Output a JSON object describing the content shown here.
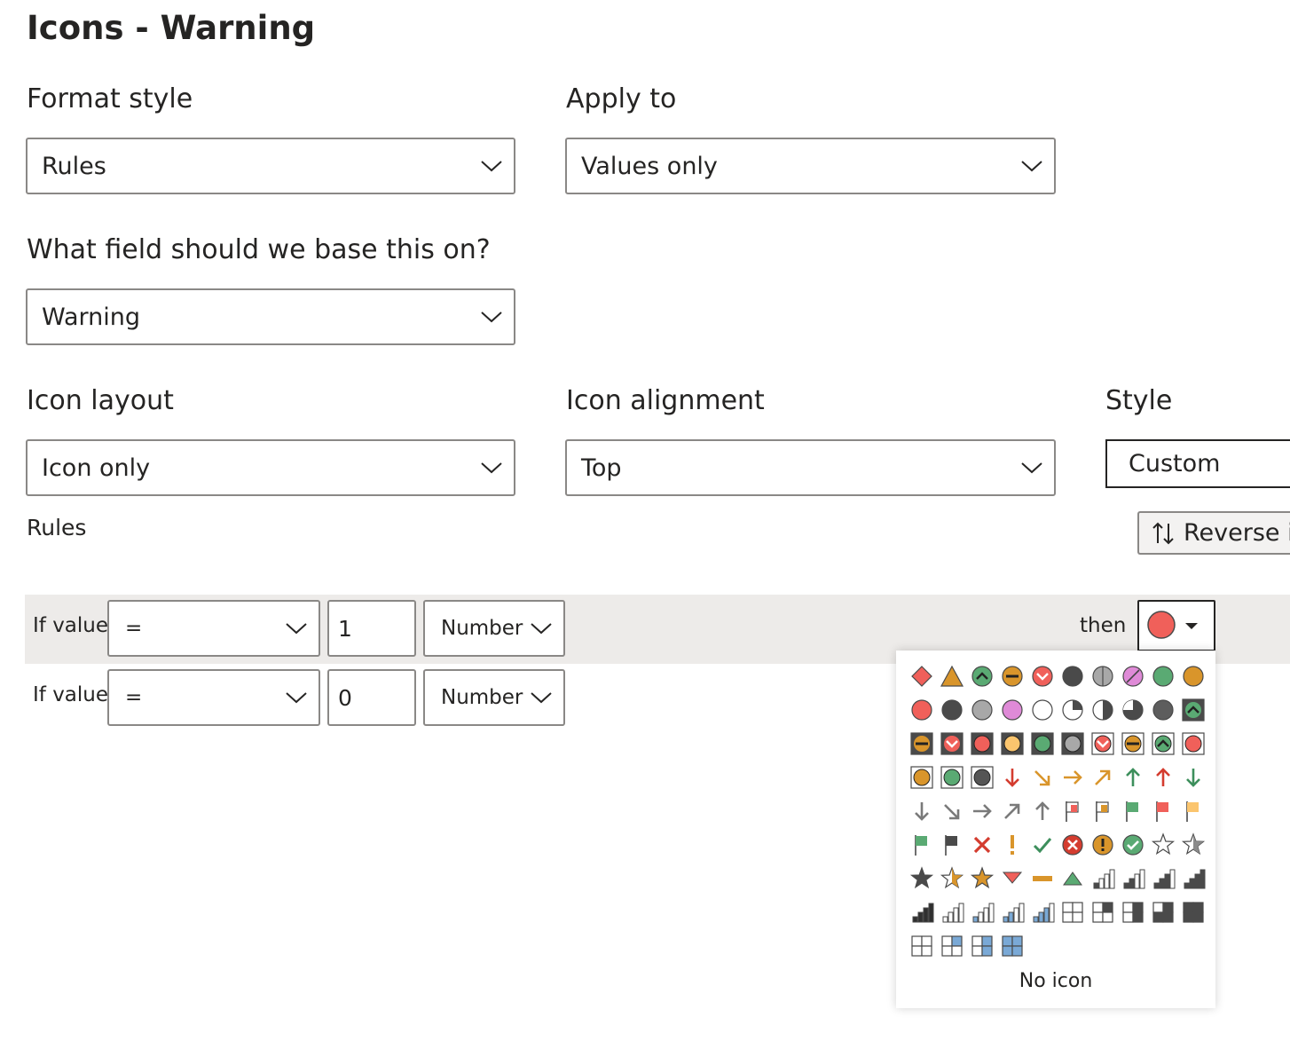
{
  "title": "Icons - Warning",
  "format_style": {
    "label": "Format style",
    "value": "Rules"
  },
  "apply_to": {
    "label": "Apply to",
    "value": "Values only"
  },
  "base_field": {
    "label": "What field should we base this on?",
    "value": "Warning"
  },
  "icon_layout": {
    "label": "Icon layout",
    "value": "Icon only"
  },
  "icon_alignment": {
    "label": "Icon alignment",
    "value": "Top"
  },
  "style": {
    "label": "Style",
    "value": "Custom"
  },
  "rules_label": "Rules",
  "reverse_button": {
    "label": "Reverse ic"
  },
  "rules": [
    {
      "if_label": "If value",
      "operator": "=",
      "value": "1",
      "type": "Number",
      "then_label": "then",
      "icon": "red-circle-icon"
    },
    {
      "if_label": "If value",
      "operator": "=",
      "value": "0",
      "type": "Number"
    }
  ],
  "icon_menu": {
    "no_icon_label": "No icon",
    "icons": [
      "red-diamond-icon",
      "orange-triangle-icon",
      "green-up-circle-icon",
      "orange-minus-circle-icon",
      "red-down-circle-icon",
      "black-circle-icon",
      "half-gray-circle-icon",
      "purple-slash-circle-icon",
      "green-circle-icon",
      "orange-circle-icon",
      "red-circle-icon",
      "black-circle-icon",
      "gray-circle-icon",
      "pink-circle-icon",
      "white-circle-icon",
      "quarter-pie-icon",
      "half-pie-icon",
      "three-quarter-pie-icon",
      "dark-gray-circle-icon",
      "green-up-square-icon",
      "orange-minus-square-icon",
      "red-down-square-icon",
      "red-circle-square-icon",
      "yellow-circle-square-icon",
      "green-circle-square-icon",
      "gray-circle-square-icon",
      "red-down-box-icon",
      "orange-minus-box-icon",
      "green-up-box-icon",
      "red-circle-box-icon",
      "orange-circle-box-icon",
      "green-circle-box-icon",
      "dark-circle-box-icon",
      "red-down-arrow-icon",
      "orange-down-right-arrow-icon",
      "orange-right-arrow-icon",
      "orange-up-right-arrow-icon",
      "green-up-arrow-icon",
      "red-up-arrow-icon",
      "green-down-arrow-icon",
      "gray-down-arrow-icon",
      "gray-down-right-arrow-icon",
      "gray-right-arrow-icon",
      "gray-up-right-arrow-icon",
      "gray-up-arrow-icon",
      "red-outline-flag-icon",
      "orange-outline-flag-icon",
      "green-flag-icon",
      "red-flag-icon",
      "yellow-flag-icon",
      "green-flag-icon",
      "black-flag-icon",
      "red-x-icon",
      "orange-exclamation-icon",
      "green-check-icon",
      "red-x-circle-icon",
      "orange-exclamation-circle-icon",
      "green-check-circle-icon",
      "empty-star-icon",
      "half-star-icon",
      "black-star-icon",
      "half-orange-star-icon",
      "orange-star-icon",
      "red-down-triangle-icon",
      "orange-dash-icon",
      "green-up-triangle-icon",
      "signal-1-bar-icon",
      "signal-2-bars-icon",
      "signal-3-bars-icon",
      "signal-4-bars-icon",
      "signal-full-icon",
      "blue-signal-0-icon",
      "blue-signal-1-icon",
      "blue-signal-2-icon",
      "blue-signal-3-icon",
      "quarters-empty-icon",
      "quarters-one-icon",
      "quarters-two-icon",
      "quarters-three-icon",
      "quarters-full-icon",
      "blue-quarters-0-icon",
      "blue-quarters-1-icon",
      "blue-quarters-2-icon",
      "blue-quarters-3-icon"
    ]
  },
  "colors": {
    "red": "#f0605a",
    "orange": "#d9952b",
    "green": "#5aaa73",
    "dark": "#4a4a4a",
    "gray": "#a8a8a8",
    "pink": "#df8ad7",
    "blue": "#7aa9d6",
    "yellow": "#fbc56e",
    "row_bg": "#edebe9"
  }
}
